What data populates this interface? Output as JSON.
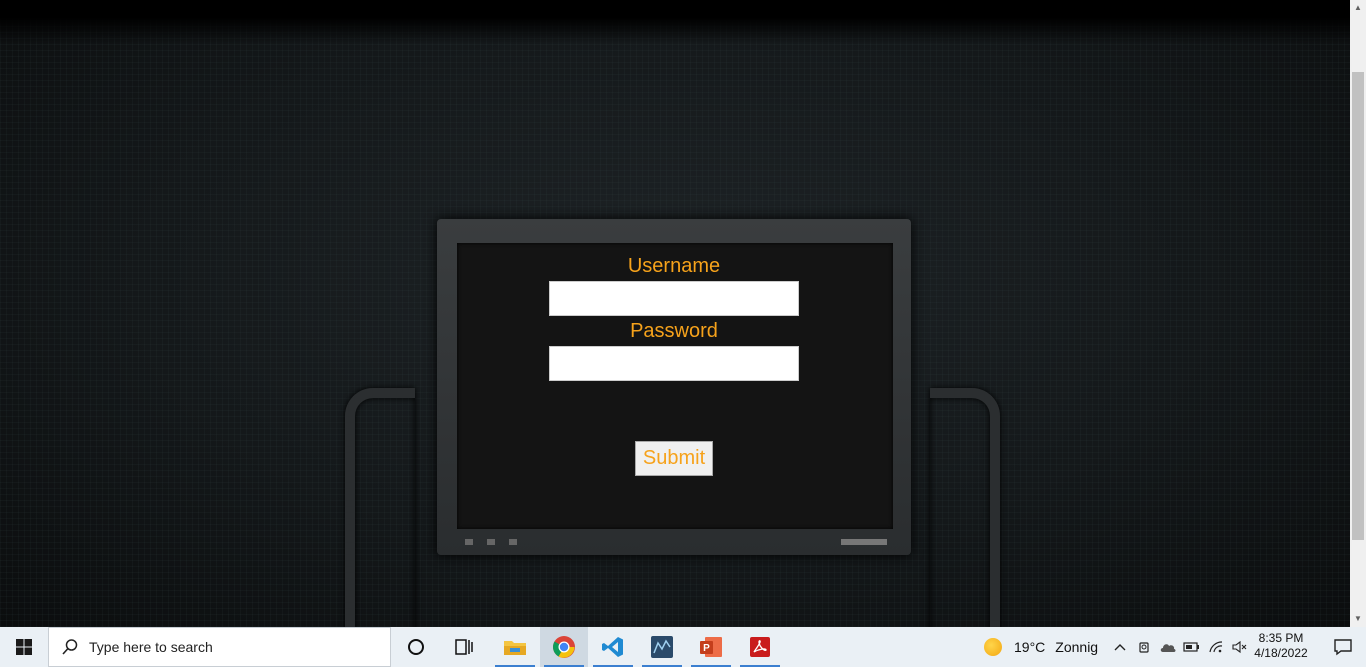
{
  "login": {
    "username_label": "Username",
    "username_value": "",
    "password_label": "Password",
    "password_value": "",
    "submit_label": "Submit",
    "accent_color": "#f6a21b"
  },
  "taskbar": {
    "search_placeholder": "Type here to search",
    "apps": [
      {
        "name": "Task View",
        "icon": "task-view-icon"
      },
      {
        "name": "File Explorer",
        "icon": "folder-icon"
      },
      {
        "name": "Google Chrome",
        "icon": "chrome-icon"
      },
      {
        "name": "Visual Studio Code",
        "icon": "vscode-icon"
      },
      {
        "name": "MySQL Workbench",
        "icon": "mysql-workbench-icon"
      },
      {
        "name": "PowerPoint",
        "icon": "powerpoint-icon"
      },
      {
        "name": "Adobe Acrobat",
        "icon": "acrobat-icon"
      }
    ],
    "weather": {
      "temperature": "19°C",
      "condition": "Zonnig"
    },
    "clock": {
      "time": "8:35 PM",
      "date": "4/18/2022"
    }
  }
}
